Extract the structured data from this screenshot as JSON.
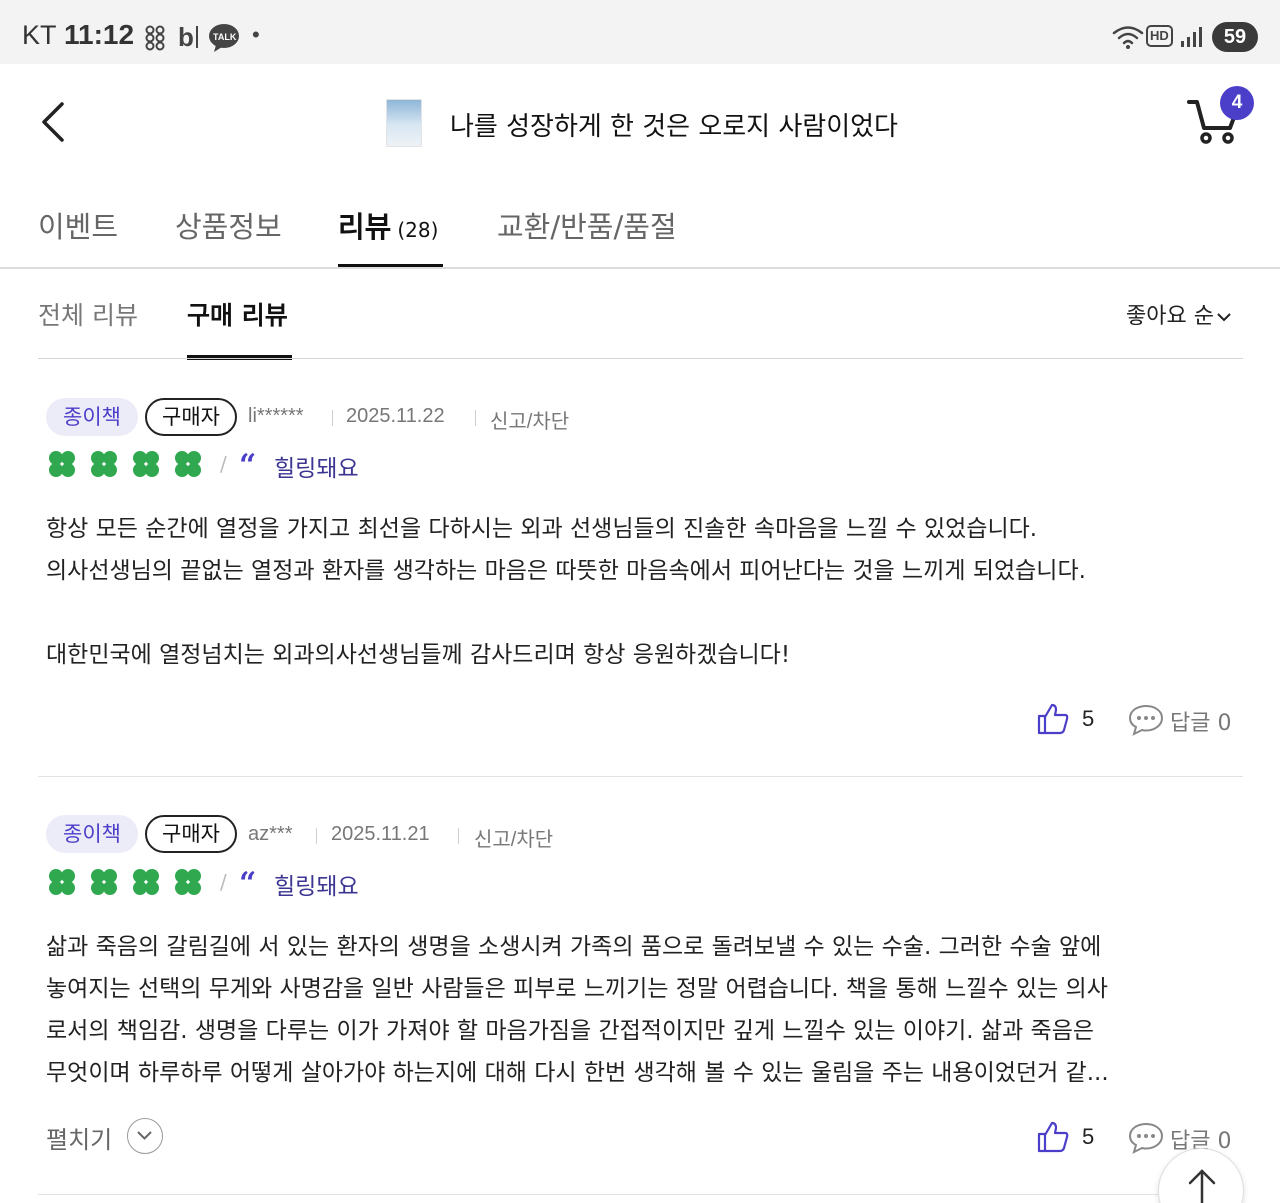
{
  "status_bar": {
    "carrier": "KT",
    "time": "11:12",
    "app_icons": [
      "threads-icon",
      "blog-icon",
      "kakaotalk-icon"
    ],
    "kakao_label": "TALK",
    "blog_label": "b",
    "dot": "•",
    "hd_label": "HD",
    "battery": "59"
  },
  "header": {
    "title": "나를 성장하게 한 것은 오로지 사람이었다",
    "cart_count": "4"
  },
  "tabs": [
    {
      "label": "이벤트"
    },
    {
      "label": "상품정보"
    },
    {
      "label": "리뷰",
      "count": "(28)"
    },
    {
      "label": "교환/반품/품절"
    }
  ],
  "subtabs": [
    {
      "label": "전체 리뷰"
    },
    {
      "label": "구매 리뷰"
    }
  ],
  "sort_label": "좋아요 순",
  "reviews": [
    {
      "format_badge": "종이책",
      "buyer_badge": "구매자",
      "user": "li******",
      "date": "2025.11.22",
      "report": "신고/차단",
      "rating": 4,
      "tag": "힐링돼요",
      "body": [
        "항상 모든 순간에 열정을 가지고 최선을 다하시는 외과 선생님들의 진솔한 속마음을 느낄 수 있었습니다.",
        "의사선생님의 끝없는 열정과 환자를 생각하는 마음은 따뜻한 마음속에서 피어난다는 것을 느끼게 되었습니다.",
        "",
        "대한민국에 열정넘치는 외과의사선생님들께 감사드리며 항상 응원하겠습니다!"
      ],
      "likes": "5",
      "reply_label": "답글 0"
    },
    {
      "format_badge": "종이책",
      "buyer_badge": "구매자",
      "user": "az***",
      "date": "2025.11.21",
      "report": "신고/차단",
      "rating": 4,
      "tag": "힐링돼요",
      "body": [
        "삶과 죽음의 갈림길에 서 있는 환자의 생명을 소생시켜 가족의 품으로 돌려보낼 수 있는 수술. 그러한 수술 앞에",
        "놓여지는 선택의 무게와 사명감을 일반 사람들은 피부로 느끼기는 정말 어렵습니다. 책을 통해 느낄수 있는 의사",
        "로서의 책임감. 생명을 다루는 이가 가져야 할 마음가짐을 간접적이지만 깊게 느낄수 있는 이야기. 삶과 죽음은",
        "무엇이며 하루하루 어떻게 살아가야 하는지에 대해 다시 한번 생각해 볼 수 있는 울림을 주는 내용이었던거 같..."
      ],
      "expand_label": "펼치기",
      "likes": "5",
      "reply_label": "답글 0"
    }
  ],
  "colors": {
    "accent": "#4b3ec9",
    "clover": "#2fa84f",
    "tag_text": "#3c3592"
  }
}
